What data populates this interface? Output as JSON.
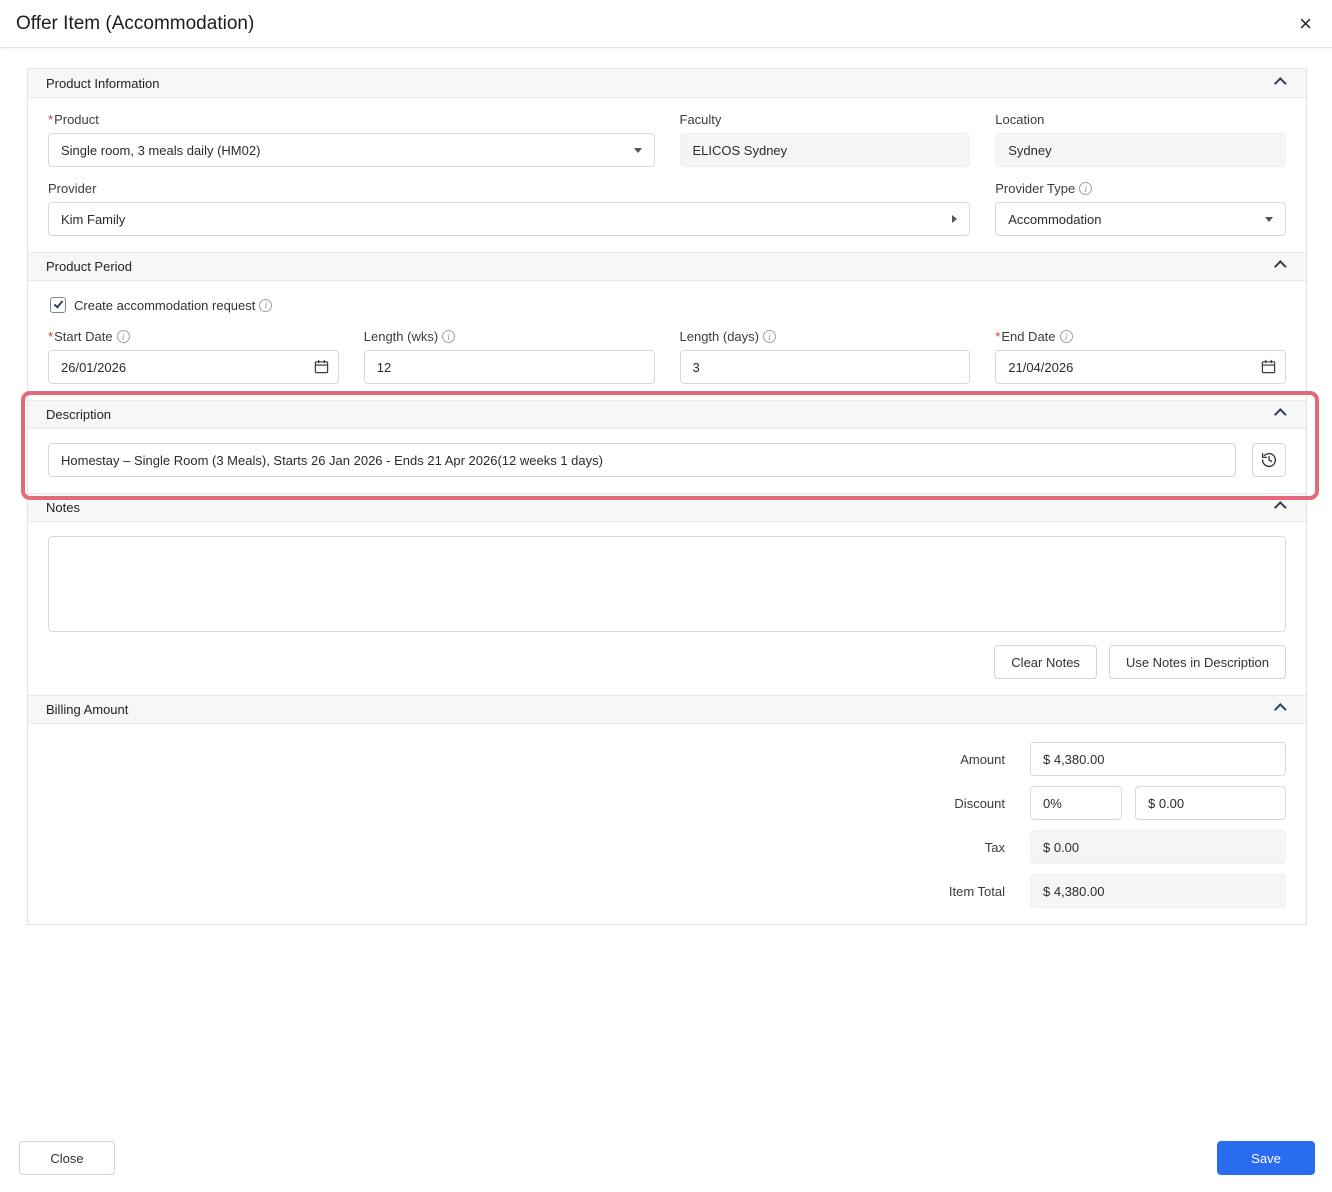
{
  "colors": {
    "accent": "#2a6cf0",
    "highlight": "#e4697a"
  },
  "modal": {
    "title": "Offer Item (Accommodation)",
    "close_icon": "×"
  },
  "product_information": {
    "title": "Product Information",
    "product": {
      "label": "Product",
      "required": true,
      "value": "Single room, 3 meals daily (HM02)"
    },
    "faculty": {
      "label": "Faculty",
      "value": "ELICOS Sydney"
    },
    "location": {
      "label": "Location",
      "value": "Sydney"
    },
    "provider": {
      "label": "Provider",
      "value": "Kim Family"
    },
    "provider_type": {
      "label": "Provider Type",
      "value": "Accommodation"
    }
  },
  "product_period": {
    "title": "Product Period",
    "create_request": {
      "label": "Create accommodation request",
      "checked": true
    },
    "start_date": {
      "label": "Start Date",
      "required": true,
      "value": "26/01/2026"
    },
    "length_wks": {
      "label": "Length (wks)",
      "value": "12"
    },
    "length_days": {
      "label": "Length (days)",
      "value": "3"
    },
    "end_date": {
      "label": "End Date",
      "required": true,
      "value": "21/04/2026"
    }
  },
  "description": {
    "title": "Description",
    "value": "Homestay – Single Room (3 Meals), Starts 26 Jan 2026 - Ends 21 Apr 2026(12 weeks 1 days)",
    "highlighted": true
  },
  "notes": {
    "title": "Notes",
    "value": "",
    "clear_button": "Clear Notes",
    "use_button": "Use Notes in Description"
  },
  "billing": {
    "title": "Billing Amount",
    "amount": {
      "label": "Amount",
      "value": "$ 4,380.00"
    },
    "discount": {
      "label": "Discount",
      "percent": "0%",
      "value": "$ 0.00"
    },
    "tax": {
      "label": "Tax",
      "value": "$ 0.00"
    },
    "item_total": {
      "label": "Item Total",
      "value": "$ 4,380.00"
    }
  },
  "footer": {
    "close_label": "Close",
    "save_label": "Save"
  }
}
